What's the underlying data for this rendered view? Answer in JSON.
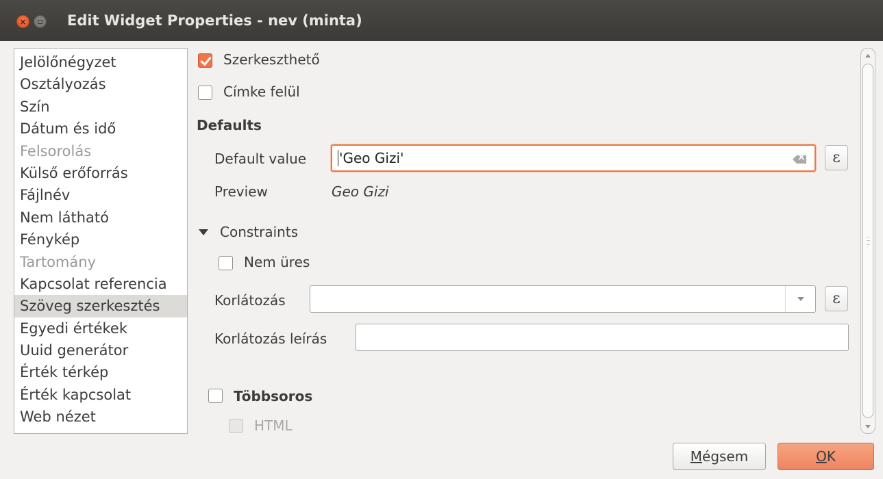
{
  "window": {
    "title": "Edit Widget Properties - nev (minta)",
    "close_symbol": "×"
  },
  "widget_list": {
    "items": [
      {
        "label": "Jelölőnégyzet",
        "state": "normal"
      },
      {
        "label": "Osztályozás",
        "state": "normal"
      },
      {
        "label": "Szín",
        "state": "normal"
      },
      {
        "label": "Dátum és idő",
        "state": "normal"
      },
      {
        "label": "Felsorolás",
        "state": "disabled"
      },
      {
        "label": "Külső erőforrás",
        "state": "normal"
      },
      {
        "label": "Fájlnév",
        "state": "normal"
      },
      {
        "label": "Nem látható",
        "state": "normal"
      },
      {
        "label": "Fénykép",
        "state": "normal"
      },
      {
        "label": "Tartomány",
        "state": "disabled"
      },
      {
        "label": "Kapcsolat referencia",
        "state": "normal"
      },
      {
        "label": "Szöveg szerkesztés",
        "state": "selected"
      },
      {
        "label": "Egyedi értékek",
        "state": "normal"
      },
      {
        "label": "Uuid generátor",
        "state": "normal"
      },
      {
        "label": "Érték térkép",
        "state": "normal"
      },
      {
        "label": "Érték kapcsolat",
        "state": "normal"
      },
      {
        "label": "Web nézet",
        "state": "normal"
      }
    ]
  },
  "options": {
    "editable_label": "Szerkeszthető",
    "editable_checked": true,
    "label_on_top_label": "Címke felül",
    "label_on_top_checked": false
  },
  "defaults": {
    "section_title": "Defaults",
    "default_value_label": "Default value",
    "default_value": "'Geo Gizi'",
    "preview_label": "Preview",
    "preview_value": "Geo Gizi",
    "expression_symbol": "ε"
  },
  "constraints": {
    "section_title": "Constraints",
    "not_null_label": "Nem üres",
    "not_null_checked": false,
    "constraint_label": "Korlátozás",
    "constraint_value": "",
    "constraint_desc_label": "Korlátozás leírás",
    "constraint_desc_value": "",
    "expression_symbol": "ε"
  },
  "multiline": {
    "label": "Többsoros",
    "checked": false,
    "html_label": "HTML",
    "html_enabled": false
  },
  "buttons": {
    "cancel_label_mnemonic": "M",
    "cancel_label_rest": "égsem",
    "ok_label_mnemonic": "O",
    "ok_label_rest": "K"
  },
  "colors": {
    "accent": "#f0764a",
    "focus_border": "#e9784c",
    "titlebar": "#3b3a36",
    "selected_row": "#dcdbd8"
  }
}
